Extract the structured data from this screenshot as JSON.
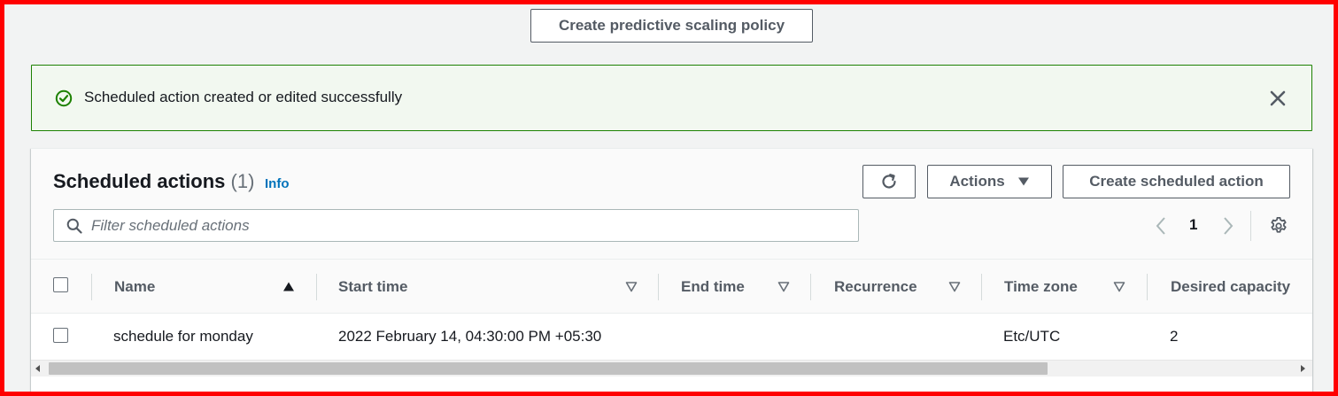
{
  "top": {
    "predictive_button": "Create predictive scaling policy"
  },
  "flash": {
    "message": "Scheduled action created or edited successfully"
  },
  "panel": {
    "title": "Scheduled actions",
    "count": "(1)",
    "info": "Info",
    "actions_label": "Actions",
    "create_button": "Create scheduled action",
    "search": {
      "placeholder": "Filter scheduled actions",
      "value": ""
    },
    "page": "1"
  },
  "table": {
    "columns": [
      "Name",
      "Start time",
      "End time",
      "Recurrence",
      "Time zone",
      "Desired capacity"
    ],
    "rows": [
      {
        "name": "schedule for monday",
        "start_time": "2022 February 14, 04:30:00 PM +05:30",
        "end_time": "",
        "recurrence": "",
        "time_zone": "Etc/UTC",
        "desired_capacity": "2"
      }
    ]
  },
  "colors": {
    "success": "#1d8102",
    "link": "#0073bb",
    "frame": "#ff0000"
  },
  "icons": [
    "check-circle-icon",
    "close-icon",
    "refresh-icon",
    "caret-down-icon",
    "search-icon",
    "chevron-left-icon",
    "chevron-right-icon",
    "gear-icon",
    "sort-ascending-icon",
    "sort-icon"
  ]
}
